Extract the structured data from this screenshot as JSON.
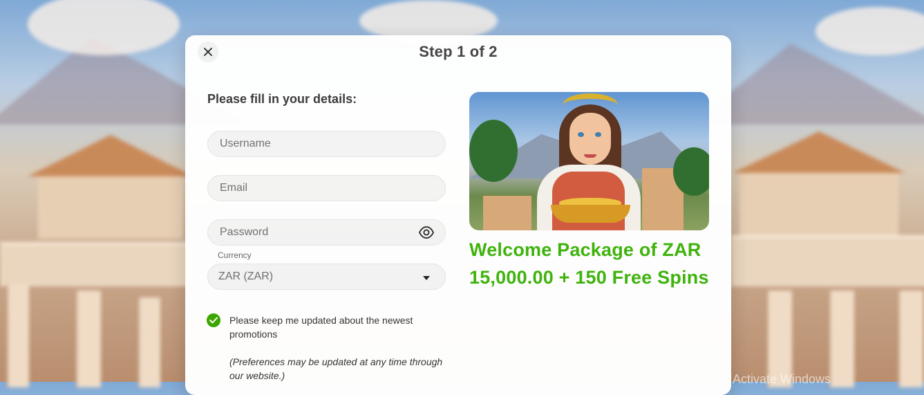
{
  "modal": {
    "step_title": "Step 1 of 2",
    "close_icon": "close-icon",
    "heading": "Please fill in your details:"
  },
  "form": {
    "username_placeholder": "Username",
    "email_placeholder": "Email",
    "password_placeholder": "Password",
    "password_toggle_icon": "eye-icon",
    "currency_label": "Currency",
    "currency_value": "ZAR (ZAR)",
    "currency_caret_icon": "caret-down-icon",
    "promotions_checkbox_checked": true,
    "promotions_text": "Please keep me updated about the newest promotions",
    "preferences_note": "(Preferences may be updated at any time through our website.)"
  },
  "promo": {
    "headline": "Welcome Package of ZAR 15,000.00 + 150 Free Spins",
    "accent_color": "#3cb40b"
  },
  "os": {
    "watermark": "Activate Windows"
  }
}
